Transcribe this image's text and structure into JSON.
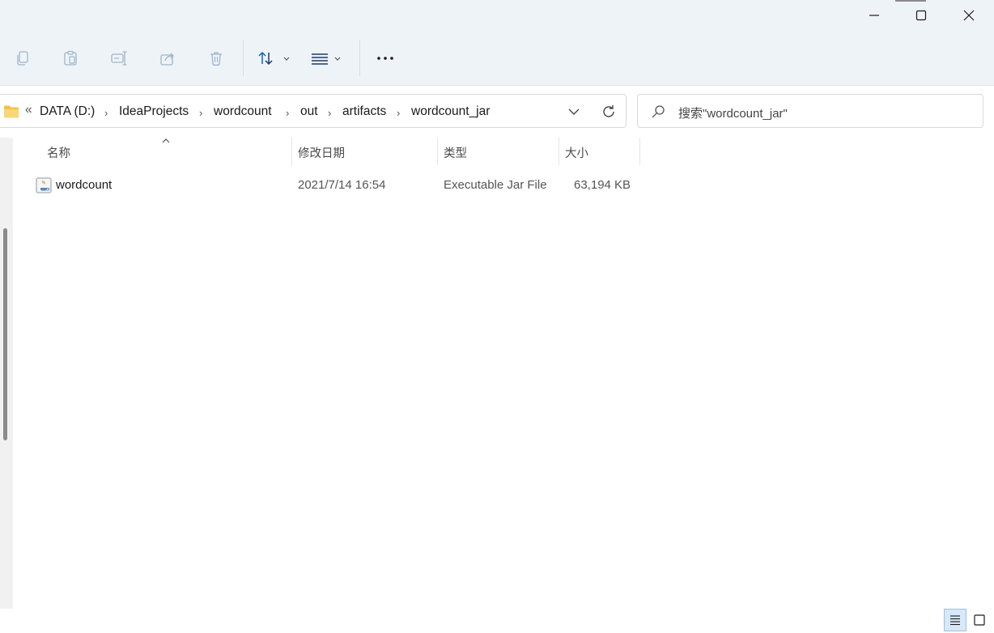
{
  "window": {
    "minimize_icon": "minimize-icon",
    "maximize_icon": "maximize-icon",
    "close_icon": "close-icon"
  },
  "toolbar": {
    "icons": [
      "copy-icon",
      "paste-icon",
      "rename-icon",
      "share-icon",
      "delete-icon",
      "sort-icon",
      "view-icon",
      "more-icon"
    ]
  },
  "address": {
    "overflow": "«",
    "crumbs": [
      "DATA (D:)",
      "IdeaProjects",
      "wordcount",
      "out",
      "artifacts",
      "wordcount_jar"
    ]
  },
  "search": {
    "placeholder": "搜索\"wordcount_jar\""
  },
  "columns": {
    "name": "名称",
    "modified": "修改日期",
    "type": "类型",
    "size": "大小"
  },
  "files": [
    {
      "name": "wordcount",
      "modified": "2021/7/14 16:54",
      "type": "Executable Jar File",
      "size": "63,194 KB"
    }
  ],
  "colors": {
    "titlebar_bg": "#eef3f8",
    "accent": "#0067c0",
    "folder": "#f3c246"
  }
}
